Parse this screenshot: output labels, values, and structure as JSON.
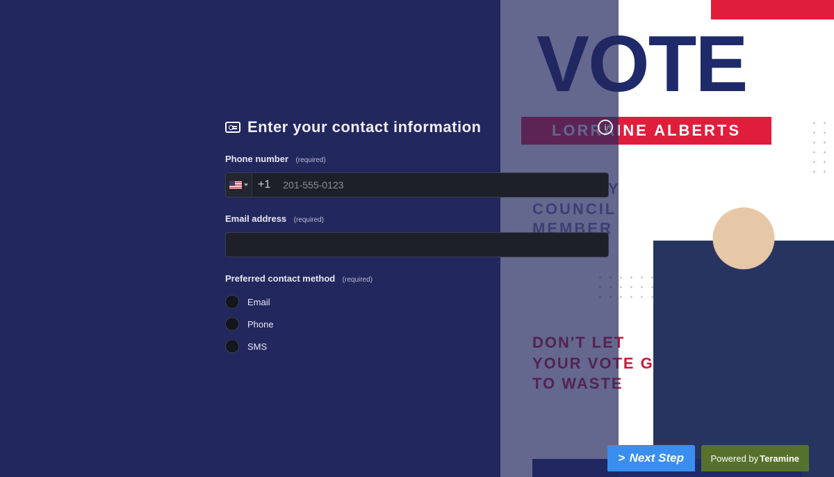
{
  "form": {
    "heading": "Enter your contact information",
    "phone": {
      "label": "Phone number",
      "required_text": "(required)",
      "dial_prefix": "+1",
      "placeholder": "201-555-0123",
      "value": ""
    },
    "email": {
      "label": "Email address",
      "required_text": "(required)",
      "value": ""
    },
    "contact_method": {
      "label": "Preferred contact method",
      "required_text": "(required)",
      "options": [
        "Email",
        "Phone",
        "SMS"
      ]
    }
  },
  "flyer": {
    "headline": "VOTE",
    "candidate_name": "LORRAINE ALBERTS",
    "subhead": "FOR CITY\nCOUNCIL\nMEMBER",
    "tagline": "DON'T LET YOUR VOTE GO TO WASTE"
  },
  "footer": {
    "next_label": "Next Step",
    "powered_prefix": "Powered by",
    "powered_brand": "Teramine"
  },
  "icons": {
    "info": "i",
    "chevron": ">"
  }
}
